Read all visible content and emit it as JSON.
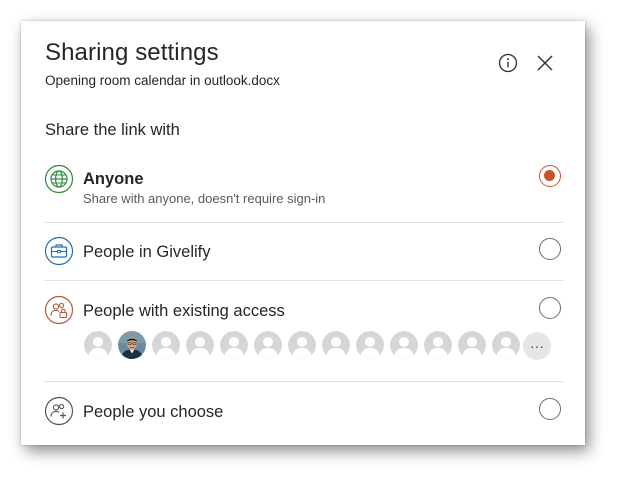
{
  "dialog": {
    "title": "Sharing settings",
    "subtitle": "Opening room calendar in outlook.docx",
    "info_icon": "info-icon",
    "close_icon": "close-icon"
  },
  "share_section": {
    "label": "Share the link with",
    "options": [
      {
        "icon": "globe-icon",
        "title": "Anyone",
        "description": "Share with anyone, doesn't require sign-in",
        "selected": true,
        "icon_color": "#2e8b3d"
      },
      {
        "icon": "briefcase-icon",
        "title": "People in Givelify",
        "selected": false,
        "icon_color": "#1f6fb5"
      },
      {
        "icon": "people-lock-icon",
        "title": "People with existing access",
        "selected": false,
        "icon_color": "#b4583a"
      },
      {
        "icon": "people-add-icon",
        "title": "People you choose",
        "selected": false,
        "icon_color": "#555555"
      }
    ],
    "existing_access_avatars": {
      "count": 13,
      "photo_index": 1,
      "more_label": "···"
    }
  },
  "colors": {
    "accent": "#c7522a",
    "text": "#262626",
    "divider": "#e1e1e1"
  }
}
